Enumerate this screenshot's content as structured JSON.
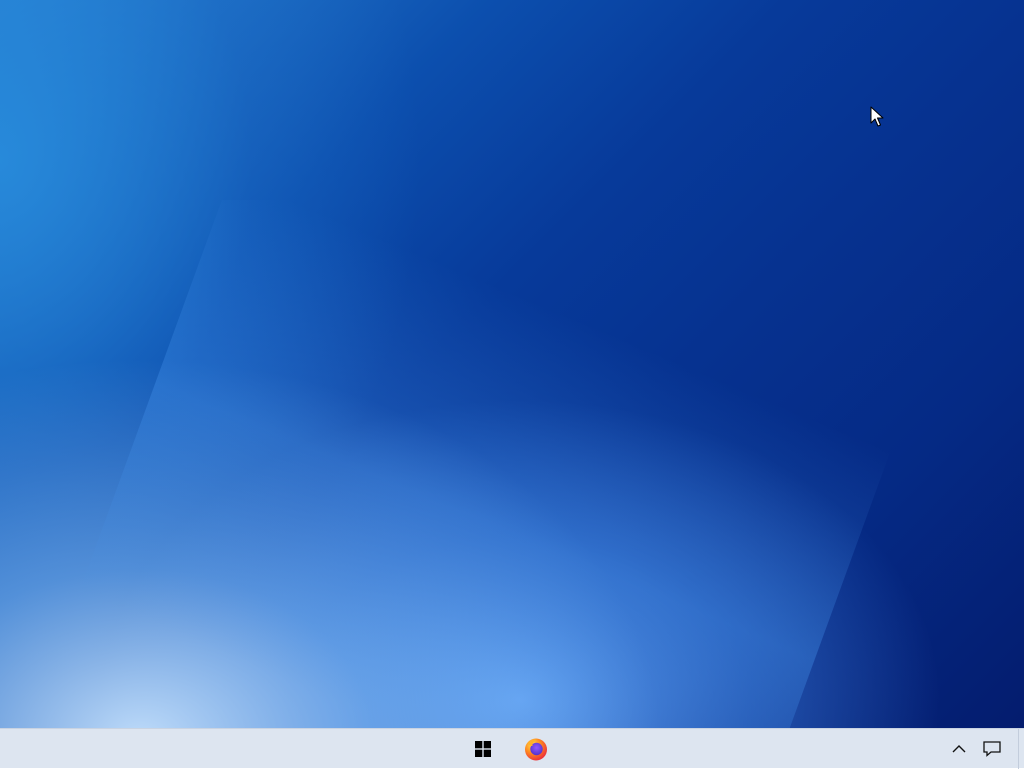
{
  "desktop": {
    "wallpaper": "blue-gradient-wallpaper",
    "colors": {
      "wallpaper_dark": "#041c6e",
      "wallpaper_mid": "#0c4fae",
      "wallpaper_light": "#c8e4ff"
    }
  },
  "taskbar": {
    "background": "#dde5f0",
    "start_icon": "windows-logo-icon",
    "pinned_apps": [
      {
        "name": "Firefox",
        "icon": "firefox-icon"
      }
    ],
    "tray": {
      "chevron_icon": "chevron-up-icon",
      "notification_icon": "notification-icon"
    }
  }
}
